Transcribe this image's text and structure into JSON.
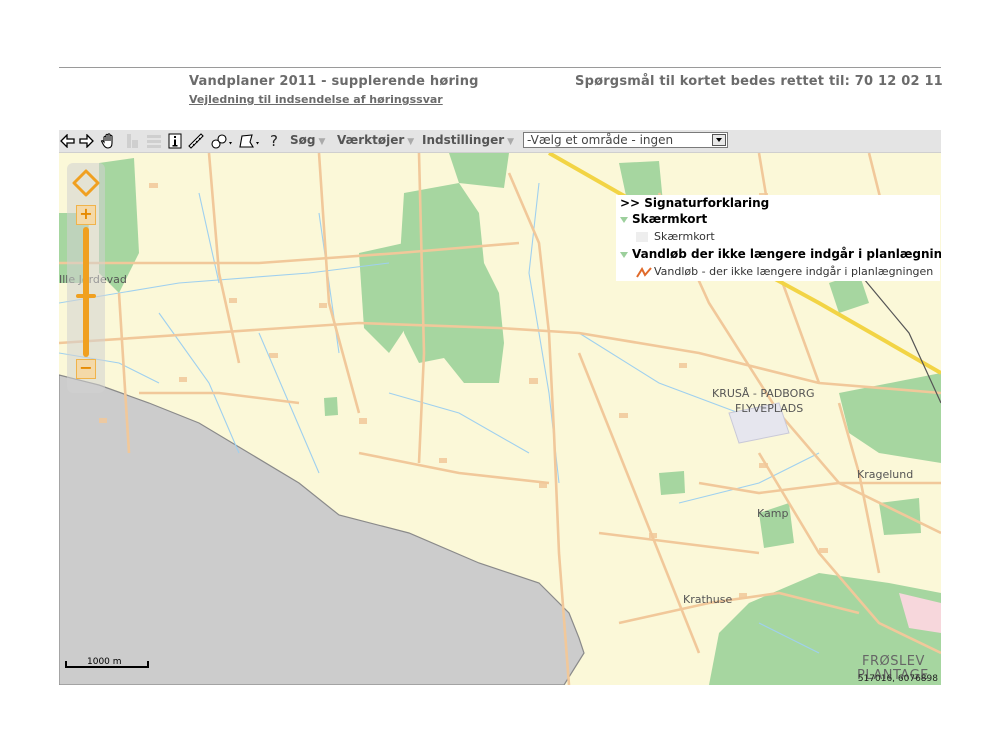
{
  "header": {
    "title": "Vandplaner 2011 - supplerende høring",
    "subtitle_link": "Vejledning til indsendelse af høringssvar",
    "contact": "Spørgsmål til kortet bedes rettet til: 70 12 02 11"
  },
  "toolbar": {
    "icons": [
      "back-arrow-icon",
      "forward-arrow-icon",
      "pan-hand-icon",
      "identify-disabled-icon",
      "layers-disabled-icon",
      "info-icon",
      "measure-ruler-icon",
      "select-features-icon",
      "draw-polygon-icon",
      "help-icon"
    ],
    "help_label": "?",
    "menus": [
      "Søg",
      "Værktøjer",
      "Indstillinger"
    ],
    "area_select": {
      "value": "-Vælg et område - ingen"
    }
  },
  "legend": {
    "header": ">> Signaturforklaring",
    "groups": [
      {
        "name": "Skærmkort",
        "items": [
          "Skærmkort"
        ]
      },
      {
        "name": "Vandløb der ikke længere indgår i planlægningen",
        "items": [
          "Vandløb - der ikke længere indgår i planlægningen"
        ]
      }
    ]
  },
  "map": {
    "place_labels": [
      {
        "text": "Ille Jordevad"
      },
      {
        "text": "KRUSÅ - PADBORG"
      },
      {
        "text": "FLYVEPLADS"
      },
      {
        "text": "Kragelund"
      },
      {
        "text": "Kamp"
      },
      {
        "text": "Krathuse"
      },
      {
        "text": "FRØSLEV"
      },
      {
        "text": "PLANTAGE"
      }
    ],
    "scale_label": "1000 m",
    "coordinates": "517016, 6076898",
    "colors": {
      "land": "#fbf8d8",
      "forest": "#a6d6a0",
      "sea": "#cccccc",
      "road": "#f1c89a",
      "water": "#9fd0ef",
      "motorway": "#f2d445"
    }
  },
  "zoom": {
    "in_label": "+",
    "out_label": "−"
  }
}
